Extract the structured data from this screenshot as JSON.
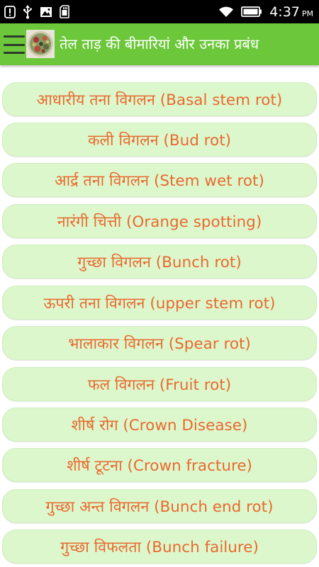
{
  "status_bar": {
    "time": "4:37",
    "ampm": "PM",
    "icons": [
      "alert-icon",
      "usb-icon",
      "image-icon",
      "sdcard-icon",
      "wifi-icon",
      "battery-icon"
    ]
  },
  "app_bar": {
    "title": "तेल ताड़ की बीमारियां और उनका प्रबंध",
    "accent_color": "#6cc83a",
    "icons": [
      "menu-icon",
      "app-logo"
    ]
  },
  "colors": {
    "item_background": "#ddf7cd",
    "item_text": "#e86a2e"
  },
  "diseases": [
    {
      "label": "आधारीय तना विगलन (Basal stem rot)"
    },
    {
      "label": "कली विगलन (Bud rot)"
    },
    {
      "label": "आर्द्र तना विगलन (Stem wet rot)"
    },
    {
      "label": "नारंगी चित्ती (Orange spotting)"
    },
    {
      "label": "गुच्छा विगलन (Bunch rot)"
    },
    {
      "label": "ऊपरी तना विगलन (upper stem rot)"
    },
    {
      "label": "भालाकार विगलन (Spear rot)"
    },
    {
      "label": "फल विगलन (Fruit rot)"
    },
    {
      "label": "शीर्ष रोग (Crown Disease)"
    },
    {
      "label": "शीर्ष टूटना (Crown fracture)"
    },
    {
      "label": "गुच्छा अन्त विगलन (Bunch end rot)"
    },
    {
      "label": "गुच्छा विफलता (Bunch failure)"
    }
  ]
}
